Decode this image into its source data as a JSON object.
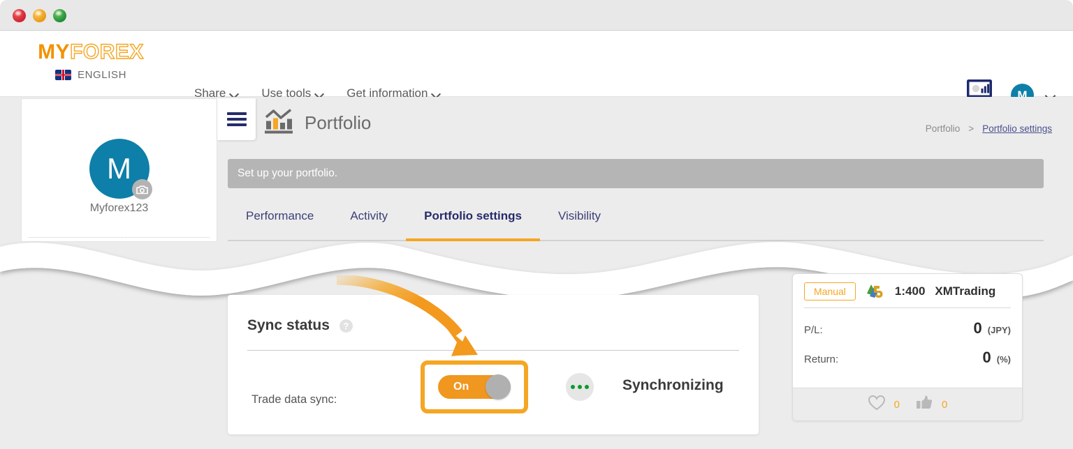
{
  "window": {
    "controls": [
      "close",
      "minimize",
      "maximize"
    ]
  },
  "header": {
    "brand": {
      "part1": "MY",
      "part2": "FOREX"
    },
    "language": {
      "label": "ENGLISH",
      "flag": "uk-flag-icon"
    },
    "nav": [
      {
        "label": "Share",
        "icon": "chevron-down-icon"
      },
      {
        "label": "Use tools",
        "icon": "chevron-down-icon"
      },
      {
        "label": "Get information",
        "icon": "chevron-down-icon"
      }
    ],
    "dashboard_icon": "laptop-dashboard-icon",
    "account": {
      "initial": "M",
      "icon": "chevron-down-icon"
    }
  },
  "sidebar": {
    "avatar_initial": "M",
    "camera_icon": "camera-icon",
    "username": "Myforex123"
  },
  "page": {
    "menu_icon": "hamburger-menu-icon",
    "title_icon": "bar-chart-icon",
    "title": "Portfolio",
    "breadcrumb": {
      "root": "Portfolio",
      "separator": ">",
      "current": "Portfolio settings"
    },
    "notice": "Set up your portfolio.",
    "tabs": [
      {
        "label": "Performance",
        "active": false
      },
      {
        "label": "Activity",
        "active": false
      },
      {
        "label": "Portfolio settings",
        "active": true
      },
      {
        "label": "Visibility",
        "active": false
      }
    ]
  },
  "sync_card": {
    "title": "Sync status",
    "help_icon": "question-mark-icon",
    "help_label": "?",
    "row_label": "Trade data sync:",
    "toggle": {
      "state_label": "On",
      "on": true
    },
    "status_icon": "three-dots-icon",
    "status_text": "Synchronizing"
  },
  "account_card": {
    "badge": "Manual",
    "platform_icon": "mt5-logo-icon",
    "leverage": "1:400",
    "broker": "XMTrading",
    "rows": [
      {
        "key": "P/L:",
        "value": "0",
        "unit": "(JPY)"
      },
      {
        "key": "Return:",
        "value": "0",
        "unit": "(%)"
      }
    ],
    "footer": [
      {
        "icon": "heart-icon",
        "count": "0"
      },
      {
        "icon": "thumbs-up-icon",
        "count": "0"
      }
    ]
  },
  "annotation": {
    "arrow_icon": "curved-arrow-icon",
    "highlight_icon": "highlight-box"
  },
  "colors": {
    "brand_orange": "#F5A623",
    "accent_orange": "#F0971F",
    "navy": "#262B6B",
    "teal": "#0E7FA8",
    "green": "#0a9b2a",
    "page_bg": "#ececec"
  }
}
